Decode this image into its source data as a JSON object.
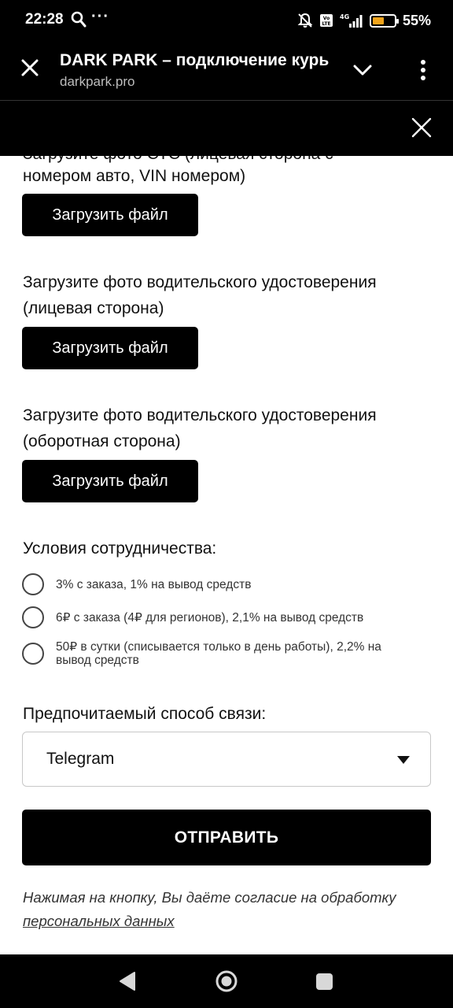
{
  "status_bar": {
    "time": "22:28",
    "dots": "···",
    "battery_level": 0.55,
    "battery_percent": "55%"
  },
  "browser": {
    "page_title": "DARK PARK – подключение курь",
    "url": "darkpark.pro"
  },
  "form": {
    "partial_label_line1": "Загрузите фото СТС (лицевая сторона с",
    "partial_label_line2": "номером авто, VIN номером)",
    "upload_label": "Загрузить файл",
    "license_front_line1": "Загрузите фото водительского удостоверения",
    "license_front_line2": "(лицевая сторона)",
    "license_back_line1": "Загрузите фото водительского удостоверения",
    "license_back_line2": "(оборотная сторона)",
    "conditions_title": "Условия сотрудничества:",
    "conditions": [
      "3% с заказа, 1% на вывод средств",
      "6₽ с заказа (4₽ для регионов), 2,1% на вывод средств",
      "50₽ в сутки (списывается только в день работы), 2,2% на вывод средств"
    ],
    "contact_title": "Предпочитаемый способ связи:",
    "contact_value": "Telegram",
    "submit_label": "ОТПРАВИТЬ",
    "consent_text": "Нажимая на кнопку, Вы даёте согласие на обработку",
    "consent_link": "персональных данных"
  },
  "colors": {
    "background": "#000000",
    "content_bg": "#ffffff",
    "battery_fill": "#f0a41c"
  }
}
